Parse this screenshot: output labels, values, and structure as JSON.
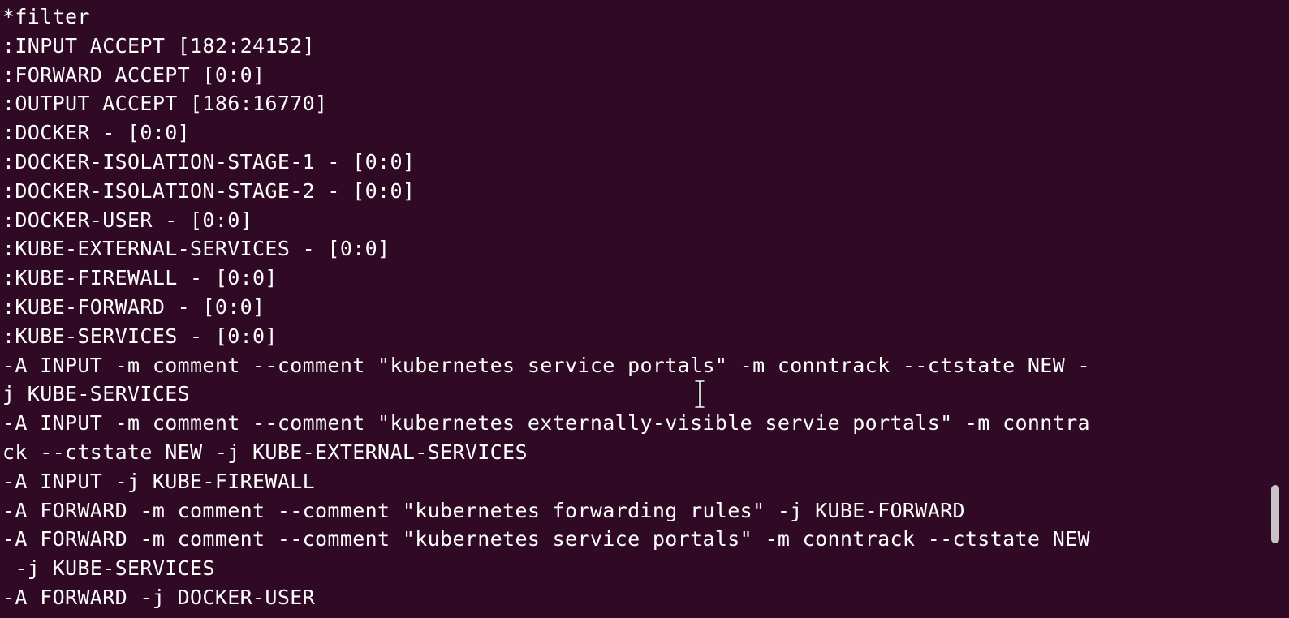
{
  "terminal": {
    "theme": {
      "background": "#300a24",
      "foreground": "#ffffff",
      "scrollbar_thumb": "#c9c2c6"
    },
    "lines": [
      "*filter",
      ":INPUT ACCEPT [182:24152]",
      ":FORWARD ACCEPT [0:0]",
      ":OUTPUT ACCEPT [186:16770]",
      ":DOCKER - [0:0]",
      ":DOCKER-ISOLATION-STAGE-1 - [0:0]",
      ":DOCKER-ISOLATION-STAGE-2 - [0:0]",
      ":DOCKER-USER - [0:0]",
      ":KUBE-EXTERNAL-SERVICES - [0:0]",
      ":KUBE-FIREWALL - [0:0]",
      ":KUBE-FORWARD - [0:0]",
      ":KUBE-SERVICES - [0:0]",
      "-A INPUT -m comment --comment \"kubernetes service portals\" -m conntrack --ctstate NEW -",
      "j KUBE-SERVICES",
      "-A INPUT -m comment --comment \"kubernetes externally-visible servie portals\" -m conntra",
      "ck --ctstate NEW -j KUBE-EXTERNAL-SERVICES",
      "-A INPUT -j KUBE-FIREWALL",
      "-A FORWARD -m comment --comment \"kubernetes forwarding rules\" -j KUBE-FORWARD",
      "-A FORWARD -m comment --comment \"kubernetes service portals\" -m conntrack --ctstate NEW",
      " -j KUBE-SERVICES",
      "-A FORWARD -j DOCKER-USER"
    ],
    "scrollbar": {
      "position_fraction": 0.82
    },
    "cursor_icon": "text-ibeam-icon"
  }
}
